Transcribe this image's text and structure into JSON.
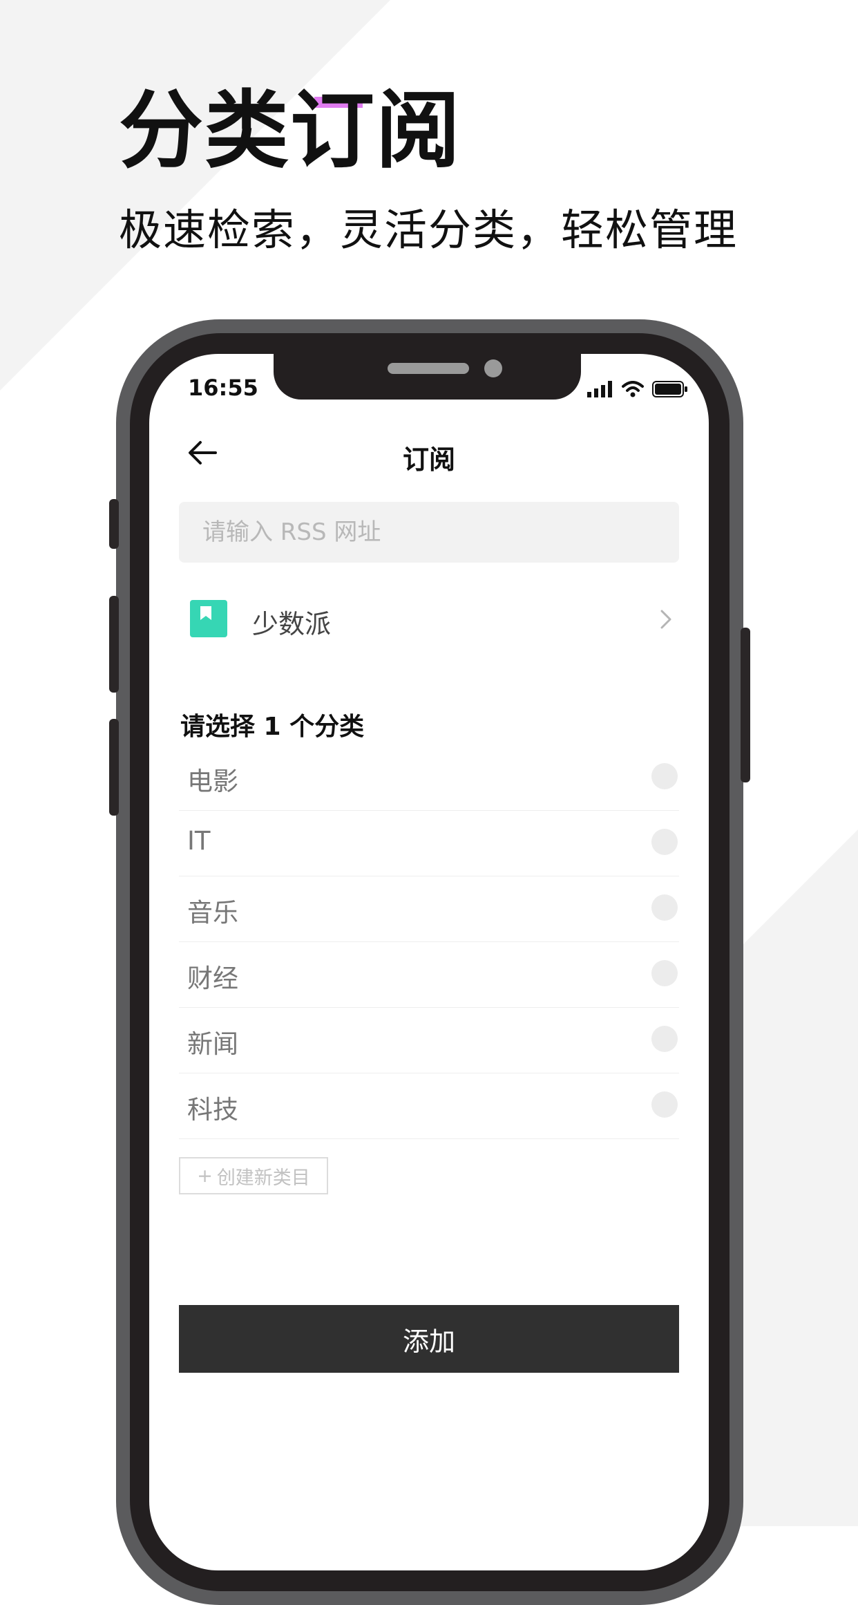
{
  "promo": {
    "headline": "分类订阅",
    "subheadline": "极速检索，灵活分类，轻松管理"
  },
  "status_bar": {
    "time": "16:55"
  },
  "nav": {
    "title": "订阅",
    "back_icon": "arrow-left-icon"
  },
  "rss_input": {
    "placeholder": "请输入 RSS 网址",
    "value": ""
  },
  "source": {
    "name": "少数派",
    "icon": "bookmark-icon",
    "icon_color": "#36d6b4"
  },
  "category_section": {
    "title": "请选择 1 个分类",
    "items": [
      {
        "label": "电影",
        "selected": false
      },
      {
        "label": "IT",
        "selected": false
      },
      {
        "label": "音乐",
        "selected": false
      },
      {
        "label": "财经",
        "selected": false
      },
      {
        "label": "新闻",
        "selected": false
      },
      {
        "label": "科技",
        "selected": false
      }
    ],
    "create_label": "创建新类目"
  },
  "actions": {
    "add_label": "添加"
  },
  "colors": {
    "accent": "#e07cf0",
    "button_bg": "#303030",
    "source_icon": "#36d6b4"
  }
}
